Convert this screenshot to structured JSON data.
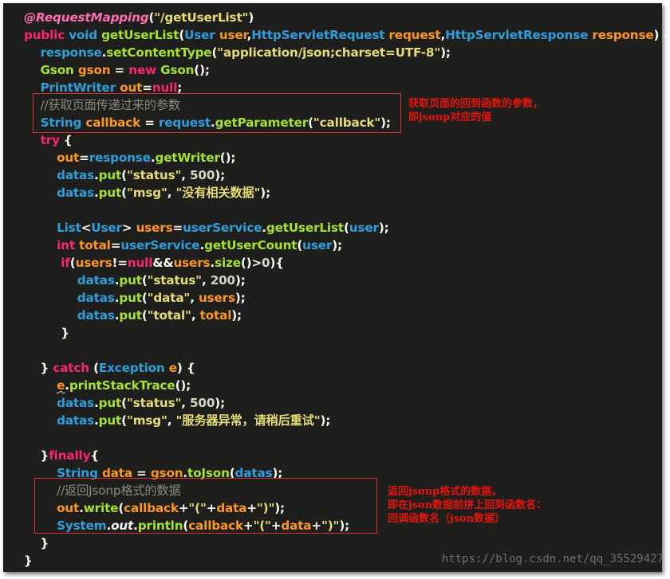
{
  "colors": {
    "background": "#1e1f1c",
    "kw": "#f92672",
    "type": "#2f9edb",
    "fn": "#a6e22e",
    "var": "#fd971f",
    "str": "#e6db74",
    "num": "#d6d6c6",
    "plain": "#f8f8f2",
    "comment": "#8a8a80",
    "ann": "#ff6fb0",
    "annot": "#e8140c"
  },
  "code_lines": [
    [
      [
        "ann",
        "@RequestMapping"
      ],
      [
        "plain",
        "("
      ],
      [
        "str",
        "\"/getUserList\""
      ],
      [
        "plain",
        ")"
      ]
    ],
    [
      [
        "kw",
        "public "
      ],
      [
        "type",
        "void "
      ],
      [
        "fn",
        "getUserList"
      ],
      [
        "plain",
        "("
      ],
      [
        "type",
        "User "
      ],
      [
        "var",
        "user"
      ],
      [
        "plain",
        ","
      ],
      [
        "type",
        "HttpServletRequest "
      ],
      [
        "var",
        "request"
      ],
      [
        "plain",
        ","
      ],
      [
        "type",
        "HttpServletResponse "
      ],
      [
        "var",
        "response"
      ],
      [
        "plain",
        ") {"
      ]
    ],
    [
      [
        "plain",
        "    "
      ],
      [
        "type",
        "response"
      ],
      [
        "plain",
        "."
      ],
      [
        "fn",
        "setContentType"
      ],
      [
        "plain",
        "("
      ],
      [
        "str",
        "\"application/json;charset=UTF-8\""
      ],
      [
        "plain",
        ");"
      ]
    ],
    [
      [
        "plain",
        "    "
      ],
      [
        "fn",
        "Gson "
      ],
      [
        "var",
        "gson"
      ],
      [
        "plain",
        " = "
      ],
      [
        "kw",
        "new "
      ],
      [
        "fn",
        "Gson"
      ],
      [
        "plain",
        "();"
      ]
    ],
    [
      [
        "plain",
        "    "
      ],
      [
        "type",
        "PrintWriter "
      ],
      [
        "var",
        "out"
      ],
      [
        "plain",
        "="
      ],
      [
        "kw",
        "null"
      ],
      [
        "plain",
        ";"
      ]
    ],
    [
      [
        "plain",
        "    "
      ],
      [
        "comment",
        "//获取页面传递过来的参数"
      ]
    ],
    [
      [
        "plain",
        "    "
      ],
      [
        "type",
        "String "
      ],
      [
        "var",
        "callback"
      ],
      [
        "plain",
        " = "
      ],
      [
        "type",
        "request"
      ],
      [
        "plain",
        "."
      ],
      [
        "fn",
        "getParameter"
      ],
      [
        "plain",
        "("
      ],
      [
        "str",
        "\"callback\""
      ],
      [
        "plain",
        ");"
      ]
    ],
    [
      [
        "plain",
        "    "
      ],
      [
        "kw",
        "try "
      ],
      [
        "plain",
        "{"
      ]
    ],
    [
      [
        "plain",
        "        "
      ],
      [
        "var",
        "out"
      ],
      [
        "plain",
        "="
      ],
      [
        "type",
        "response"
      ],
      [
        "plain",
        "."
      ],
      [
        "fn",
        "getWriter"
      ],
      [
        "plain",
        "();"
      ]
    ],
    [
      [
        "plain",
        "        "
      ],
      [
        "type",
        "datas"
      ],
      [
        "plain",
        "."
      ],
      [
        "fn",
        "put"
      ],
      [
        "plain",
        "("
      ],
      [
        "str",
        "\"status\""
      ],
      [
        "plain",
        ", "
      ],
      [
        "num",
        "500"
      ],
      [
        "plain",
        ");"
      ]
    ],
    [
      [
        "plain",
        "        "
      ],
      [
        "type",
        "datas"
      ],
      [
        "plain",
        "."
      ],
      [
        "fn",
        "put"
      ],
      [
        "plain",
        "("
      ],
      [
        "str",
        "\"msg\""
      ],
      [
        "plain",
        ", "
      ],
      [
        "str",
        "\"没有相关数据\""
      ],
      [
        "plain",
        ");"
      ]
    ],
    [],
    [
      [
        "plain",
        "        "
      ],
      [
        "type",
        "List"
      ],
      [
        "plain",
        "<"
      ],
      [
        "type",
        "User"
      ],
      [
        "plain",
        "> "
      ],
      [
        "var",
        "users"
      ],
      [
        "plain",
        "="
      ],
      [
        "type",
        "userService"
      ],
      [
        "plain",
        "."
      ],
      [
        "fn",
        "getUserList"
      ],
      [
        "plain",
        "("
      ],
      [
        "type",
        "user"
      ],
      [
        "plain",
        ");"
      ]
    ],
    [
      [
        "plain",
        "        "
      ],
      [
        "kw",
        "int "
      ],
      [
        "var",
        "total"
      ],
      [
        "plain",
        "="
      ],
      [
        "type",
        "userService"
      ],
      [
        "plain",
        "."
      ],
      [
        "fn",
        "getUserCount"
      ],
      [
        "plain",
        "("
      ],
      [
        "type",
        "user"
      ],
      [
        "plain",
        ");"
      ]
    ],
    [
      [
        "plain",
        "         "
      ],
      [
        "kw",
        "if"
      ],
      [
        "plain",
        "("
      ],
      [
        "var",
        "users"
      ],
      [
        "plain",
        "!="
      ],
      [
        "kw",
        "null"
      ],
      [
        "plain",
        "&&"
      ],
      [
        "var",
        "users"
      ],
      [
        "plain",
        "."
      ],
      [
        "fn",
        "size"
      ],
      [
        "plain",
        "()>"
      ],
      [
        "num",
        "0"
      ],
      [
        "plain",
        "){"
      ]
    ],
    [
      [
        "plain",
        "             "
      ],
      [
        "type",
        "datas"
      ],
      [
        "plain",
        "."
      ],
      [
        "fn",
        "put"
      ],
      [
        "plain",
        "("
      ],
      [
        "str",
        "\"status\""
      ],
      [
        "plain",
        ", "
      ],
      [
        "num",
        "200"
      ],
      [
        "plain",
        ");"
      ]
    ],
    [
      [
        "plain",
        "             "
      ],
      [
        "type",
        "datas"
      ],
      [
        "plain",
        "."
      ],
      [
        "fn",
        "put"
      ],
      [
        "plain",
        "("
      ],
      [
        "str",
        "\"data\""
      ],
      [
        "plain",
        ", "
      ],
      [
        "var",
        "users"
      ],
      [
        "plain",
        ");"
      ]
    ],
    [
      [
        "plain",
        "             "
      ],
      [
        "type",
        "datas"
      ],
      [
        "plain",
        "."
      ],
      [
        "fn",
        "put"
      ],
      [
        "plain",
        "("
      ],
      [
        "str",
        "\"total\""
      ],
      [
        "plain",
        ", "
      ],
      [
        "var",
        "total"
      ],
      [
        "plain",
        ");"
      ]
    ],
    [
      [
        "plain",
        "         }"
      ]
    ],
    [],
    [
      [
        "plain",
        "    } "
      ],
      [
        "kw",
        "catch "
      ],
      [
        "plain",
        "("
      ],
      [
        "type",
        "Exception "
      ],
      [
        "var",
        "e"
      ],
      [
        "plain",
        ") {"
      ]
    ],
    [
      [
        "plain",
        "        "
      ],
      [
        "var",
        "e"
      ],
      [
        "plain",
        "."
      ],
      [
        "fn",
        "printStackTrace"
      ],
      [
        "plain",
        "();"
      ]
    ],
    [
      [
        "plain",
        "        "
      ],
      [
        "type",
        "datas"
      ],
      [
        "plain",
        "."
      ],
      [
        "fn",
        "put"
      ],
      [
        "plain",
        "("
      ],
      [
        "str",
        "\"status\""
      ],
      [
        "plain",
        ", "
      ],
      [
        "num",
        "500"
      ],
      [
        "plain",
        ");"
      ]
    ],
    [
      [
        "plain",
        "        "
      ],
      [
        "type",
        "datas"
      ],
      [
        "plain",
        "."
      ],
      [
        "fn",
        "put"
      ],
      [
        "plain",
        "("
      ],
      [
        "str",
        "\"msg\""
      ],
      [
        "plain",
        ", "
      ],
      [
        "str",
        "\"服务器异常，请稍后重试\""
      ],
      [
        "plain",
        ");"
      ]
    ],
    [],
    [
      [
        "plain",
        "    }"
      ],
      [
        "kw",
        "finally"
      ],
      [
        "plain",
        "{"
      ]
    ],
    [
      [
        "plain",
        "        "
      ],
      [
        "type",
        "String "
      ],
      [
        "var",
        "data"
      ],
      [
        "plain",
        " = "
      ],
      [
        "var",
        "gson"
      ],
      [
        "plain",
        "."
      ],
      [
        "fn",
        "toJson"
      ],
      [
        "plain",
        "("
      ],
      [
        "type",
        "datas"
      ],
      [
        "plain",
        ");"
      ]
    ],
    [
      [
        "plain",
        "        "
      ],
      [
        "comment",
        "//返回Jsonp格式的数据"
      ]
    ],
    [
      [
        "plain",
        "        "
      ],
      [
        "var",
        "out"
      ],
      [
        "plain",
        "."
      ],
      [
        "fn",
        "write"
      ],
      [
        "plain",
        "("
      ],
      [
        "var",
        "callback"
      ],
      [
        "plain",
        "+"
      ],
      [
        "str",
        "\"(\""
      ],
      [
        "plain",
        "+"
      ],
      [
        "var",
        "data"
      ],
      [
        "plain",
        "+"
      ],
      [
        "str",
        "\")\""
      ],
      [
        "plain",
        ");"
      ]
    ],
    [
      [
        "plain",
        "        "
      ],
      [
        "type",
        "System"
      ],
      [
        "plain",
        "."
      ],
      [
        "var",
        "out"
      ],
      [
        "plain",
        "."
      ],
      [
        "fn",
        "println"
      ],
      [
        "plain",
        "("
      ],
      [
        "var",
        "callback"
      ],
      [
        "plain",
        "+"
      ],
      [
        "str",
        "\"(\""
      ],
      [
        "plain",
        "+"
      ],
      [
        "var",
        "data"
      ],
      [
        "plain",
        "+"
      ],
      [
        "str",
        "\")\""
      ],
      [
        "plain",
        ");"
      ]
    ],
    [
      [
        "plain",
        "    }"
      ]
    ],
    [
      [
        "plain",
        "}"
      ]
    ]
  ],
  "annotations": [
    {
      "text": "获取页面的回到函数的参数，\n即jsonp对应的值"
    },
    {
      "text": "返回jsonp格式的数据，\n即在json数据前拼上回到函数名：\n回调函数名（json数据）"
    }
  ],
  "watermark": "https://blog.csdn.net/qq_35529427"
}
